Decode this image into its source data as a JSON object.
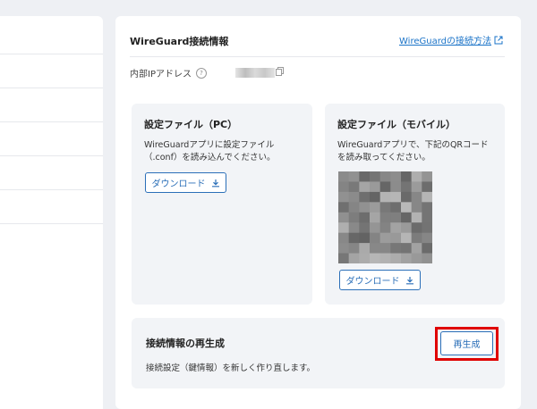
{
  "wireguard": {
    "title": "WireGuard接続情報",
    "help_link": "WireGuardの接続方法",
    "internal_ip_label": "内部IPアドレス"
  },
  "pc": {
    "title": "設定ファイル（PC）",
    "desc": "WireGuardアプリに設定ファイル（.conf）を読み込んでください。",
    "download_label": "ダウンロード"
  },
  "mobile": {
    "title": "設定ファイル（モバイル）",
    "desc": "WireGuardアプリで、下記のQRコードを読み取ってください。",
    "download_label": "ダウンロード"
  },
  "regen": {
    "title": "接続情報の再生成",
    "desc": "接続設定（鍵情報）を新しく作り直します。",
    "button_label": "再生成"
  },
  "icons": {
    "external_link": "external-link-icon",
    "help": "question-circle-icon",
    "copy": "copy-icon",
    "download": "download-icon"
  },
  "colors": {
    "accent": "#2b6fb8",
    "highlight": "#e00000"
  }
}
